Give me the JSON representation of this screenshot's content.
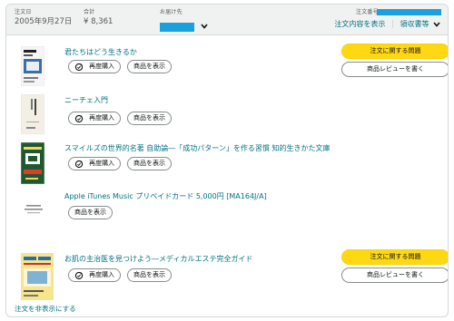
{
  "header": {
    "order_date_label": "注文日",
    "order_date": "2005年9月27日",
    "total_label": "合計",
    "total": "¥ 8,361",
    "ship_to_label": "お届け先",
    "order_number_label": "注文番号",
    "order_details_link": "注文内容を表示",
    "receipt_link": "領収書等",
    "redaction_color": "#1aa0dd"
  },
  "common": {
    "rebuy_label": "再度購入",
    "view_item_label": "商品を表示",
    "order_issue_label": "注文に関する問題",
    "write_review_label": "商品レビューを書く",
    "hide_order_label": "注文を非表示にする"
  },
  "items": [
    {
      "title": "君たちはどう生きるか"
    },
    {
      "title": "ニーチェ入門"
    },
    {
      "title": "スマイルズの世界的名著 自助論―「成功パターン」を作る習慣 知的生きかた文庫"
    },
    {
      "title": "Apple iTunes Music プリペイドカード 5,000円 [MA164J/A]"
    },
    {
      "title": "お肌の主治医を見つけよう―メディカルエステ完全ガイド"
    }
  ],
  "colors": {
    "link": "#007185",
    "primary_button": "#ffd814",
    "header_bg": "#f0f2f2"
  }
}
